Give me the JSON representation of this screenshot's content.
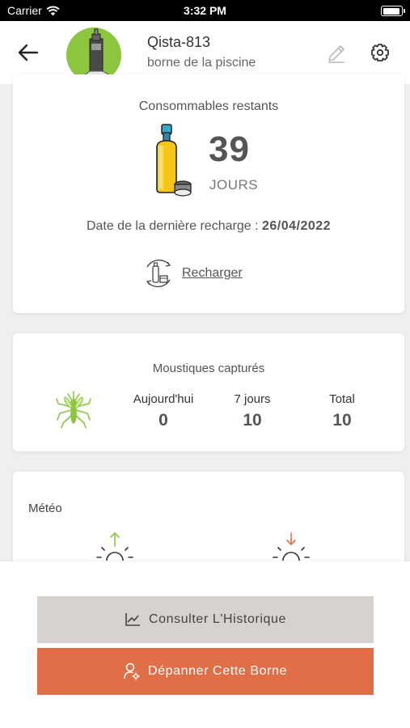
{
  "status_bar": {
    "carrier": "Carrier",
    "time": "3:32 PM"
  },
  "header": {
    "device_name": "Qista-813",
    "device_location": "borne de la piscine"
  },
  "consumables": {
    "title": "Consommables restants",
    "days_value": "39",
    "days_unit": "JOURS",
    "recharge_date_label": "Date de la dernière recharge :",
    "recharge_date_value": "26/04/2022",
    "recharge_action": "Recharger"
  },
  "mosquitoes": {
    "title": "Moustiques capturés",
    "stats": [
      {
        "label": "Aujourd'hui",
        "value": "0"
      },
      {
        "label": "7 jours",
        "value": "10"
      },
      {
        "label": "Total",
        "value": "10"
      }
    ]
  },
  "weather": {
    "title": "Météo"
  },
  "actions": {
    "history_label": "Consulter L'Historique",
    "repair_label": "Dépanner Cette Borne"
  },
  "colors": {
    "accent_orange": "#e06f48",
    "accent_green": "#8cc63f",
    "button_gray": "#d7d2d0"
  },
  "icons": {
    "back": "arrow-left-icon",
    "edit": "pencil-icon",
    "settings": "gear-icon",
    "bottle": "bottle-icon",
    "recharge": "recharge-icon",
    "mosquito": "mosquito-icon",
    "sunrise": "sunrise-icon",
    "sunset": "sunset-icon",
    "history": "chart-icon",
    "repair": "user-wrench-icon"
  }
}
